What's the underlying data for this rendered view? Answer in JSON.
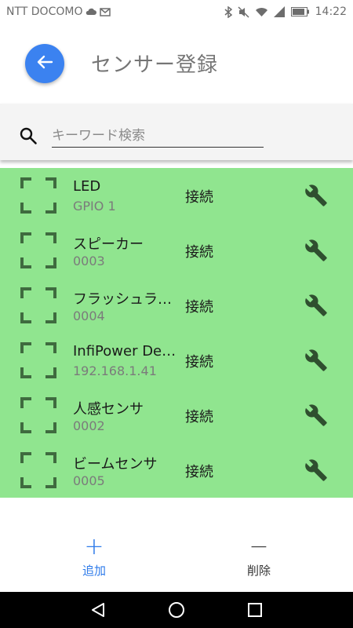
{
  "status_bar": {
    "carrier": "NTT DOCOMO",
    "time": "14:22"
  },
  "header": {
    "title": "センサー登録",
    "back_icon": "arrow-back-icon",
    "back_color": "#3b82f0"
  },
  "search": {
    "placeholder": "キーワード検索",
    "value": ""
  },
  "list": {
    "background": "#90e58f",
    "items": [
      {
        "name": "LED",
        "id": "GPIO 1",
        "action": "接続"
      },
      {
        "name": "スピーカー",
        "id": "0003",
        "action": "接続"
      },
      {
        "name": "フラッシュライト",
        "id": "0004",
        "action": "接続"
      },
      {
        "name": "InfiPower Device",
        "id": "192.168.1.41",
        "action": "接続"
      },
      {
        "name": "人感センサ",
        "id": "0002",
        "action": "接続"
      },
      {
        "name": "ビームセンサ",
        "id": "0005",
        "action": "接続"
      }
    ]
  },
  "bottom": {
    "add_symbol": "+",
    "add_label": "追加",
    "delete_symbol": "−",
    "delete_label": "削除",
    "accent": "#2f7bea"
  }
}
